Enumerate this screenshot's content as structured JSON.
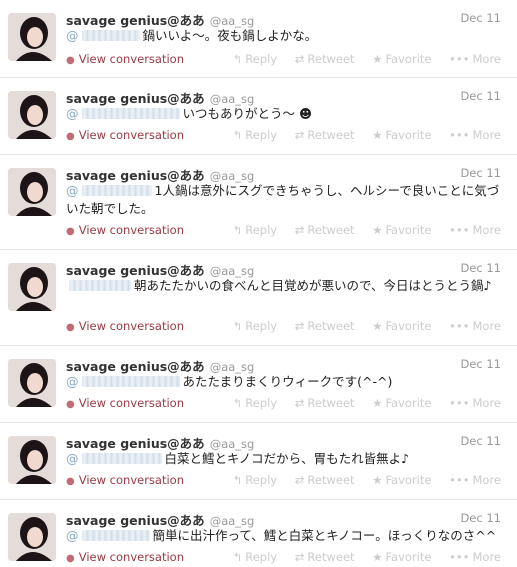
{
  "labels": {
    "view_conversation": "View conversation",
    "reply": "Reply",
    "retweet": "Retweet",
    "favorite": "Favorite",
    "more": "More"
  },
  "icons": {
    "conversation": "speech-bubble-icon",
    "reply": "reply-arrow-icon",
    "retweet": "retweet-icon",
    "favorite": "star-icon",
    "more": "more-dots-icon"
  },
  "colors": {
    "mention": "#8aa9c8",
    "view_conversation": "#9a3a45",
    "actions_muted": "#cccccc"
  },
  "tweets": [
    {
      "name": "savage genius@ああ",
      "handle": "@aa_sg",
      "date": "Dec 11",
      "mention": "@",
      "text": "鍋いいよ〜。夜も鍋しよかな。"
    },
    {
      "name": "savage genius@ああ",
      "handle": "@aa_sg",
      "date": "Dec 11",
      "mention": "@",
      "text": "いつもありがとう〜 ☻"
    },
    {
      "name": "savage genius@ああ",
      "handle": "@aa_sg",
      "date": "Dec 11",
      "mention": "@",
      "text": "1人鍋は意外にスグできちゃうし、ヘルシーで良いことに気づいた朝でした。"
    },
    {
      "name": "savage genius@ああ",
      "handle": "@aa_sg",
      "date": "Dec 11",
      "mention": "",
      "text": "朝あたたかいの食べんと目覚めが悪いので、今日はとうとう鍋♪"
    },
    {
      "name": "savage genius@ああ",
      "handle": "@aa_sg",
      "date": "Dec 11",
      "mention": "@",
      "text": "あたたまりまくりウィークです(^-^)"
    },
    {
      "name": "savage genius@ああ",
      "handle": "@aa_sg",
      "date": "Dec 11",
      "mention": "@",
      "text": "白菜と鱈とキノコだから、胃もたれ皆無よ♪"
    },
    {
      "name": "savage genius@ああ",
      "handle": "@aa_sg",
      "date": "Dec 11",
      "mention": "@",
      "text": "簡単に出汁作って、鱈と白菜とキノコー。ほっくりなのさ^^"
    }
  ]
}
